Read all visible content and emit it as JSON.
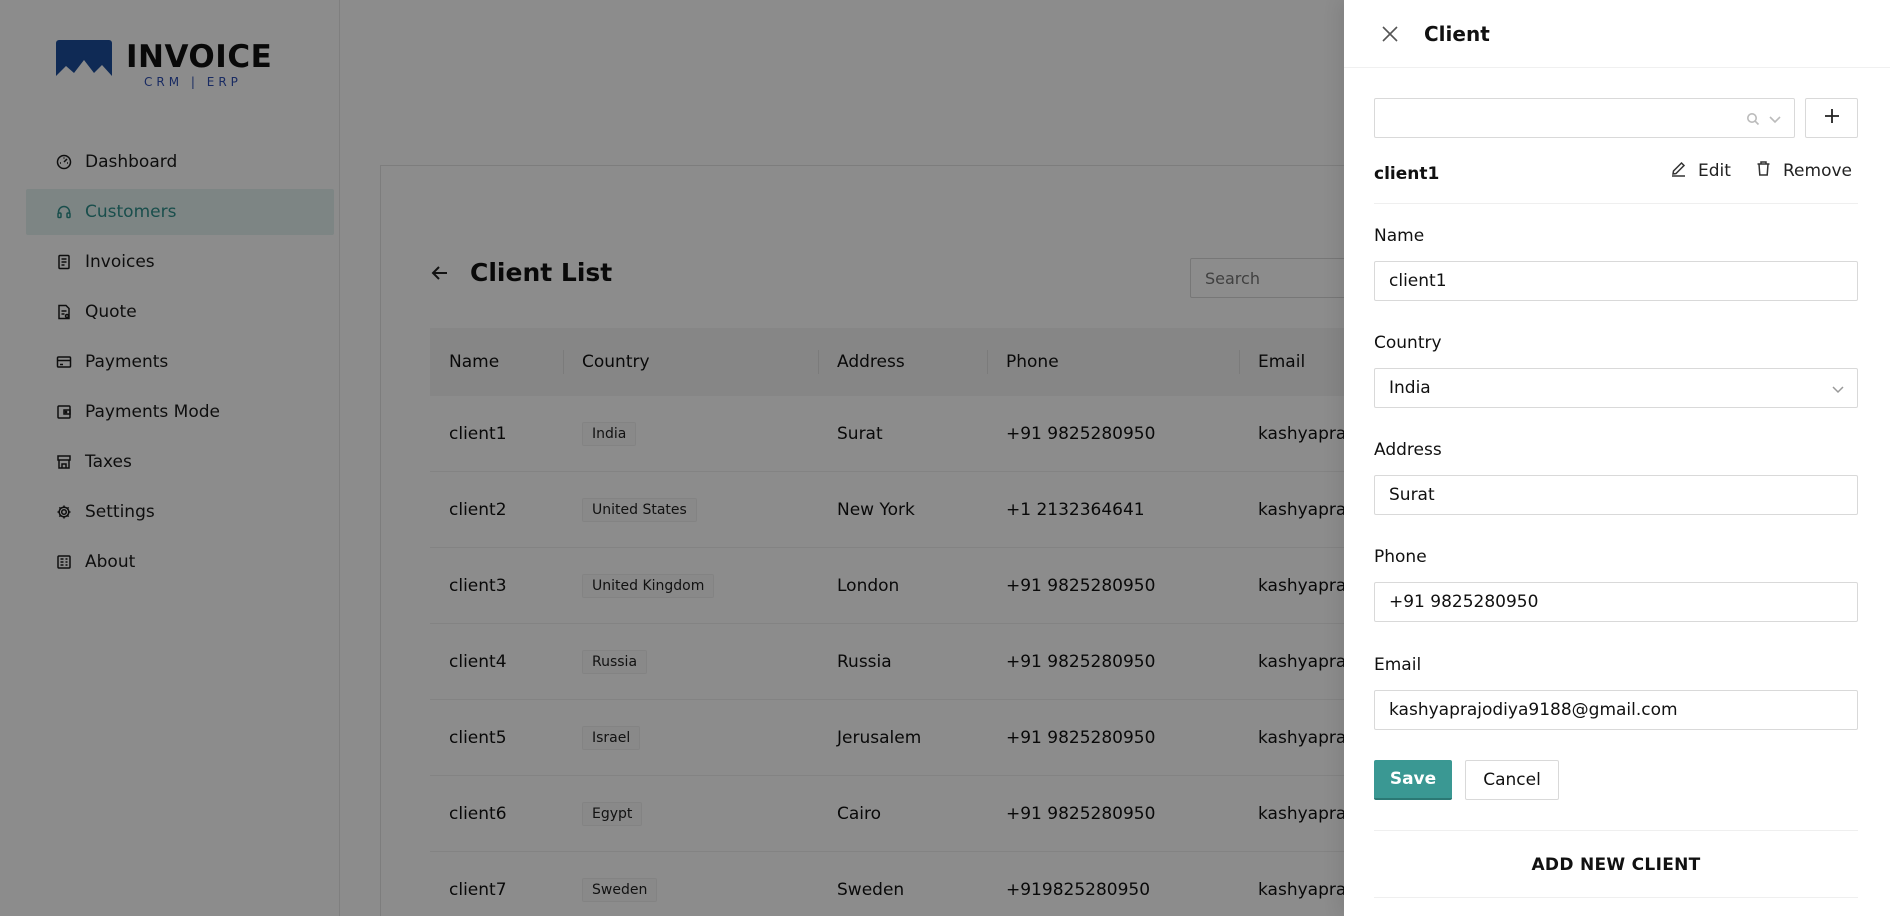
{
  "brand": {
    "title": "INVOICE",
    "subtitle": "CRM | ERP",
    "logo_color": "#1d4e9c"
  },
  "sidebar": {
    "items": [
      {
        "label": "Dashboard",
        "icon": "dashboard-icon",
        "active": false
      },
      {
        "label": "Customers",
        "icon": "headset-icon",
        "active": true
      },
      {
        "label": "Invoices",
        "icon": "invoice-icon",
        "active": false
      },
      {
        "label": "Quote",
        "icon": "quote-icon",
        "active": false
      },
      {
        "label": "Payments",
        "icon": "credit-card-icon",
        "active": false
      },
      {
        "label": "Payments Mode",
        "icon": "wallet-icon",
        "active": false
      },
      {
        "label": "Taxes",
        "icon": "shop-icon",
        "active": false
      },
      {
        "label": "Settings",
        "icon": "gear-icon",
        "active": false
      },
      {
        "label": "About",
        "icon": "bank-icon",
        "active": false
      }
    ]
  },
  "client_list": {
    "title": "Client List",
    "search_placeholder": "Search",
    "columns": [
      "Name",
      "Country",
      "Address",
      "Phone",
      "Email"
    ],
    "rows": [
      {
        "name": "client1",
        "country": "India",
        "address": "Surat",
        "phone": "+91 9825280950",
        "email": "kashyapraj"
      },
      {
        "name": "client2",
        "country": "United States",
        "address": "New York",
        "phone": "+1 2132364641",
        "email": "kashyapraj"
      },
      {
        "name": "client3",
        "country": "United Kingdom",
        "address": "London",
        "phone": "+91 9825280950",
        "email": "kashyapraj"
      },
      {
        "name": "client4",
        "country": "Russia",
        "address": "Russia",
        "phone": "+91 9825280950",
        "email": "kashyapraj"
      },
      {
        "name": "client5",
        "country": "Israel",
        "address": "Jerusalem",
        "phone": "+91 9825280950",
        "email": "kashyapraj"
      },
      {
        "name": "client6",
        "country": "Egypt",
        "address": "Cairo",
        "phone": "+91 9825280950",
        "email": "kashyapraj"
      },
      {
        "name": "client7",
        "country": "Sweden",
        "address": "Sweden",
        "phone": "+919825280950",
        "email": "kashyapraj"
      }
    ]
  },
  "drawer": {
    "title": "Client",
    "selected_client": "client1",
    "edit_label": "Edit",
    "remove_label": "Remove",
    "fields": {
      "name": {
        "label": "Name",
        "value": "client1"
      },
      "country": {
        "label": "Country",
        "value": "India"
      },
      "address": {
        "label": "Address",
        "value": "Surat"
      },
      "phone": {
        "label": "Phone",
        "value": "+91 9825280950"
      },
      "email": {
        "label": "Email",
        "value": "kashyaprajodiya9188@gmail.com"
      }
    },
    "save_label": "Save",
    "cancel_label": "Cancel",
    "add_new_label": "ADD NEW CLIENT"
  },
  "colors": {
    "accent": "#3a9893",
    "active_bg": "#e3f2f0",
    "active_text": "#2e8f8a"
  }
}
